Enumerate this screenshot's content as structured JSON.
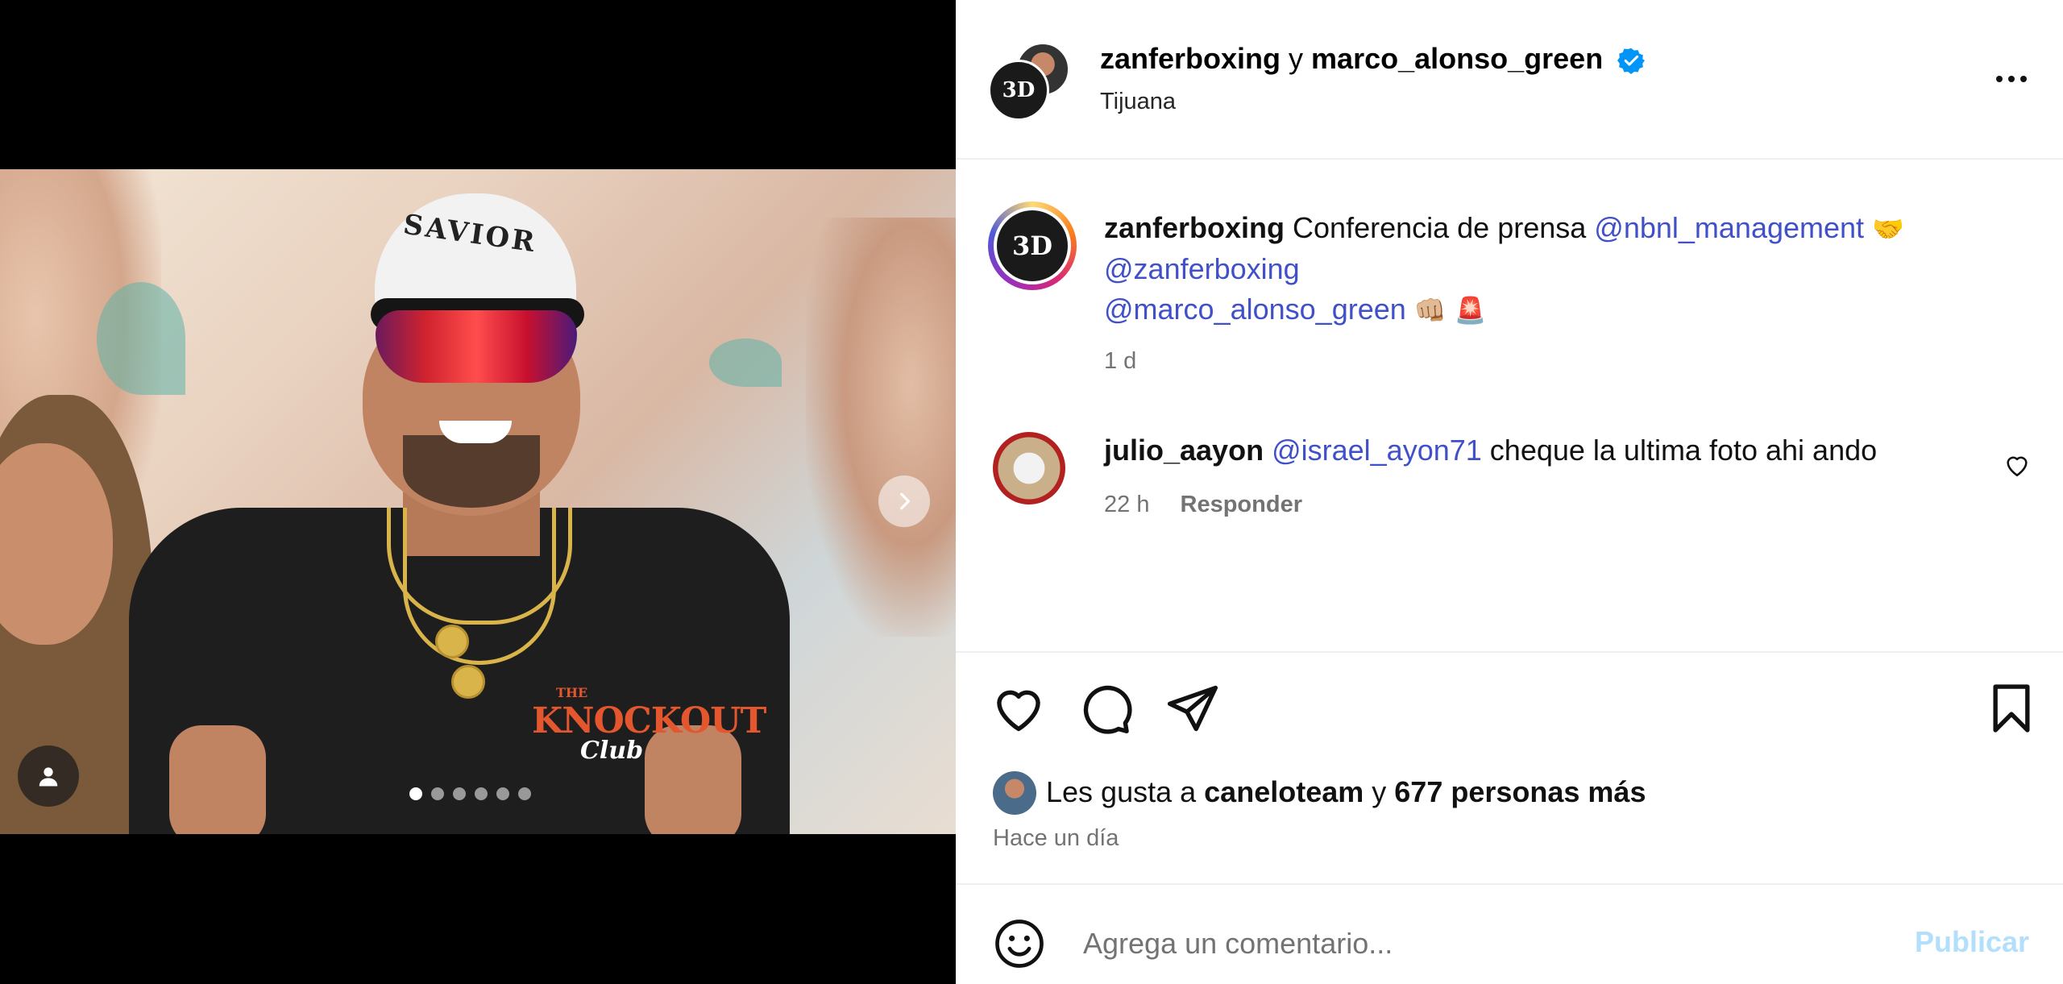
{
  "header": {
    "user1": "zanferboxing",
    "conj": "y",
    "user2": "marco_alonso_green",
    "location": "Tijuana",
    "avatar_text": "3D"
  },
  "media": {
    "cap_text": "SAVIOR",
    "shirt_logo_1": "THE",
    "shirt_logo_2": "KNOCKOUT",
    "shirt_logo_3": "Club",
    "slide_count": 6,
    "active_slide": 1
  },
  "caption": {
    "username": "zanferboxing",
    "text": "Conferencia de prensa",
    "mention1": "@nbnl_management",
    "emoji1": "🤝",
    "mention2": "@zanferboxing",
    "mention3": "@marco_alonso_green",
    "emoji2": "👊🏼",
    "emoji3": "🚨",
    "time": "1 d"
  },
  "comment": {
    "username": "julio_aayon",
    "mention": "@israel_ayon71",
    "text": "cheque la ultima foto ahi ando",
    "time": "22 h",
    "reply_label": "Responder"
  },
  "likes": {
    "prefix": "Les gusta a",
    "user": "caneloteam",
    "conj": "y",
    "others": "677 personas más",
    "posted": "Hace un día"
  },
  "composer": {
    "placeholder": "Agrega un comentario...",
    "publish_label": "Publicar"
  },
  "icons": {
    "heart": "heart-icon",
    "comment": "comment-icon",
    "share": "share-icon",
    "save": "bookmark-icon",
    "emoji": "emoji-icon",
    "more": "more-icon",
    "verified": "verified-icon",
    "next": "chevron-right-icon",
    "user_tag": "user-tag-icon"
  },
  "colors": {
    "mention": "#4050c8",
    "verified": "#0095f6",
    "publish_disabled": "#b2dffc",
    "muted": "#737373"
  }
}
